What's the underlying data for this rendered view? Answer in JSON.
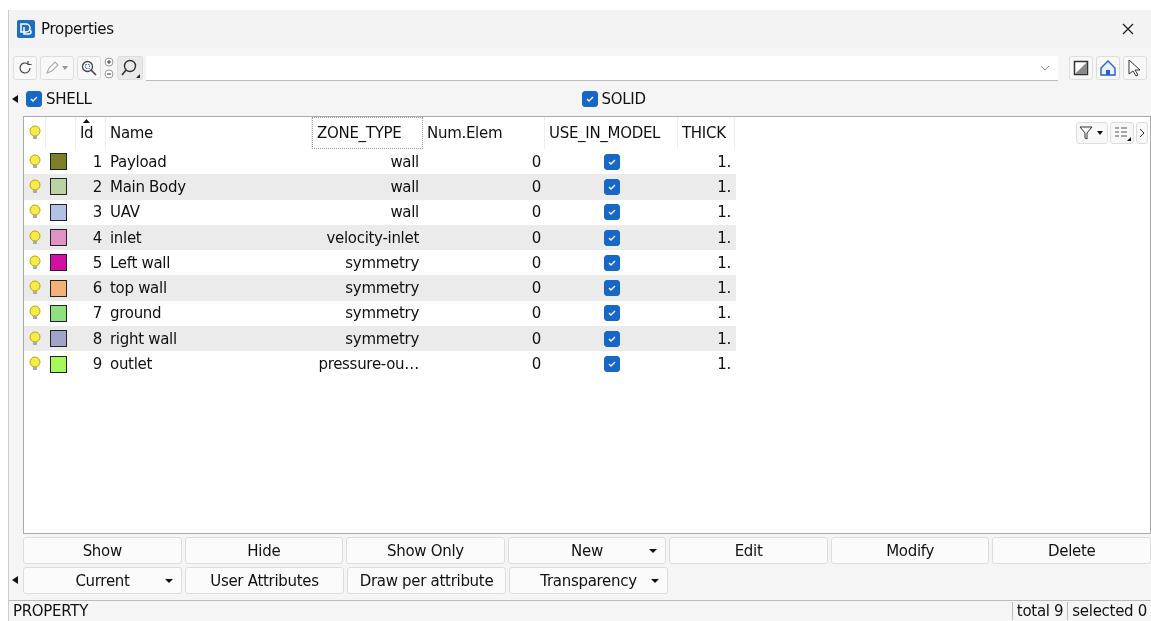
{
  "window": {
    "title": "Properties"
  },
  "filters": [
    {
      "label": "SHELL",
      "checked": true
    },
    {
      "label": "SOLID",
      "checked": true
    }
  ],
  "table": {
    "columns": [
      {
        "label": "Id",
        "sorted": true
      },
      {
        "label": "Name",
        "sorted": false
      },
      {
        "label": "ZONE_TYPE",
        "sorted": false
      },
      {
        "label": "Num.Elem",
        "sorted": false
      },
      {
        "label": "USE_IN_MODEL",
        "sorted": false
      },
      {
        "label": "THICK",
        "sorted": false
      }
    ],
    "rows": [
      {
        "id": "1",
        "name": "Payload",
        "color": "#7f7f2a",
        "zone_type": "wall",
        "num_elem": "0",
        "use_in_model": true,
        "thick": "1."
      },
      {
        "id": "2",
        "name": "Main Body",
        "color": "#b9d3a2",
        "zone_type": "wall",
        "num_elem": "0",
        "use_in_model": true,
        "thick": "1."
      },
      {
        "id": "3",
        "name": "UAV",
        "color": "#b3c1e6",
        "zone_type": "wall",
        "num_elem": "0",
        "use_in_model": true,
        "thick": "1."
      },
      {
        "id": "4",
        "name": "inlet",
        "color": "#de93c3",
        "zone_type": "velocity-inlet",
        "num_elem": "0",
        "use_in_model": true,
        "thick": "1."
      },
      {
        "id": "5",
        "name": "Left wall",
        "color": "#d011a3",
        "zone_type": "symmetry",
        "num_elem": "0",
        "use_in_model": true,
        "thick": "1."
      },
      {
        "id": "6",
        "name": "top wall",
        "color": "#f6b076",
        "zone_type": "symmetry",
        "num_elem": "0",
        "use_in_model": true,
        "thick": "1."
      },
      {
        "id": "7",
        "name": "ground",
        "color": "#8fe07f",
        "zone_type": "symmetry",
        "num_elem": "0",
        "use_in_model": true,
        "thick": "1."
      },
      {
        "id": "8",
        "name": "right wall",
        "color": "#a2a3c9",
        "zone_type": "symmetry",
        "num_elem": "0",
        "use_in_model": true,
        "thick": "1."
      },
      {
        "id": "9",
        "name": "outlet",
        "color": "#a6f85a",
        "zone_type": "pressure-ou…",
        "num_elem": "0",
        "use_in_model": true,
        "thick": "1."
      }
    ]
  },
  "buttons": [
    [
      {
        "label": "Show",
        "kind": "plain"
      },
      {
        "label": "Hide",
        "kind": "plain"
      },
      {
        "label": "Show Only",
        "kind": "plain"
      },
      {
        "label": "New",
        "kind": "dropdown"
      },
      {
        "label": "Edit",
        "kind": "plain"
      },
      {
        "label": "Modify",
        "kind": "plain"
      },
      {
        "label": "Delete",
        "kind": "plain"
      }
    ],
    [
      {
        "label": "Current",
        "kind": "dropdown"
      },
      {
        "label": "User Attributes",
        "kind": "plain"
      },
      {
        "label": "Draw per attribute",
        "kind": "plain"
      },
      {
        "label": "Transparency",
        "kind": "dropdown"
      }
    ]
  ],
  "status_bar": {
    "label": "PROPERTY",
    "total": "total 9",
    "selected": "selected 0"
  }
}
